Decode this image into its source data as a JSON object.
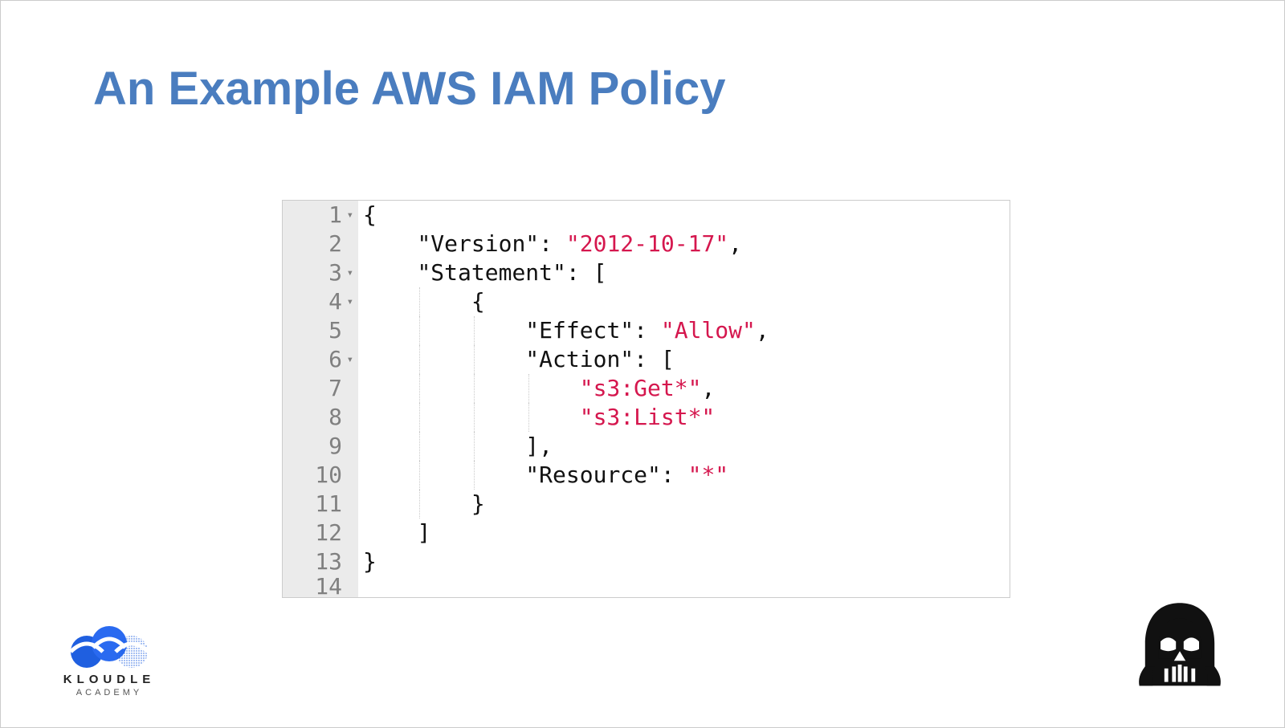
{
  "title": "An Example AWS IAM Policy",
  "code": {
    "lines": [
      {
        "num": "1",
        "fold": true,
        "indent": 0,
        "guides": [],
        "tokens": [
          {
            "t": "{",
            "c": "punct"
          }
        ]
      },
      {
        "num": "2",
        "fold": false,
        "indent": 1,
        "guides": [],
        "tokens": [
          {
            "t": "\"Version\"",
            "c": "key"
          },
          {
            "t": ": ",
            "c": "punct"
          },
          {
            "t": "\"2012-10-17\"",
            "c": "str"
          },
          {
            "t": ",",
            "c": "punct"
          }
        ]
      },
      {
        "num": "3",
        "fold": true,
        "indent": 1,
        "guides": [],
        "tokens": [
          {
            "t": "\"Statement\"",
            "c": "key"
          },
          {
            "t": ": [",
            "c": "punct"
          }
        ]
      },
      {
        "num": "4",
        "fold": true,
        "indent": 2,
        "guides": [
          "g1"
        ],
        "tokens": [
          {
            "t": "{",
            "c": "punct"
          }
        ]
      },
      {
        "num": "5",
        "fold": false,
        "indent": 3,
        "guides": [
          "g1",
          "g2"
        ],
        "tokens": [
          {
            "t": "\"Effect\"",
            "c": "key"
          },
          {
            "t": ": ",
            "c": "punct"
          },
          {
            "t": "\"Allow\"",
            "c": "str"
          },
          {
            "t": ",",
            "c": "punct"
          }
        ]
      },
      {
        "num": "6",
        "fold": true,
        "indent": 3,
        "guides": [
          "g1",
          "g2"
        ],
        "tokens": [
          {
            "t": "\"Action\"",
            "c": "key"
          },
          {
            "t": ": [",
            "c": "punct"
          }
        ]
      },
      {
        "num": "7",
        "fold": false,
        "indent": 4,
        "guides": [
          "g1",
          "g2",
          "g3"
        ],
        "tokens": [
          {
            "t": "\"s3:Get*\"",
            "c": "str"
          },
          {
            "t": ",",
            "c": "punct"
          }
        ]
      },
      {
        "num": "8",
        "fold": false,
        "indent": 4,
        "guides": [
          "g1",
          "g2",
          "g3"
        ],
        "tokens": [
          {
            "t": "\"s3:List*\"",
            "c": "str"
          }
        ]
      },
      {
        "num": "9",
        "fold": false,
        "indent": 3,
        "guides": [
          "g1",
          "g2"
        ],
        "tokens": [
          {
            "t": "],",
            "c": "punct"
          }
        ]
      },
      {
        "num": "10",
        "fold": false,
        "indent": 3,
        "guides": [
          "g1",
          "g2"
        ],
        "tokens": [
          {
            "t": "\"Resource\"",
            "c": "key"
          },
          {
            "t": ": ",
            "c": "punct"
          },
          {
            "t": "\"*\"",
            "c": "str"
          }
        ]
      },
      {
        "num": "11",
        "fold": false,
        "indent": 2,
        "guides": [
          "g1"
        ],
        "tokens": [
          {
            "t": "}",
            "c": "punct"
          }
        ]
      },
      {
        "num": "12",
        "fold": false,
        "indent": 1,
        "guides": [],
        "tokens": [
          {
            "t": "]",
            "c": "punct"
          }
        ]
      },
      {
        "num": "13",
        "fold": false,
        "indent": 0,
        "guides": [],
        "tokens": [
          {
            "t": "}",
            "c": "punct"
          }
        ]
      },
      {
        "num": "14",
        "fold": false,
        "indent": 0,
        "guides": [],
        "tokens": [],
        "partial": true
      }
    ]
  },
  "brand": {
    "name": "KLOUDLE",
    "sub": "ACADEMY"
  },
  "icons": {
    "vader": "darth-vader-icon",
    "fold": "▾"
  }
}
